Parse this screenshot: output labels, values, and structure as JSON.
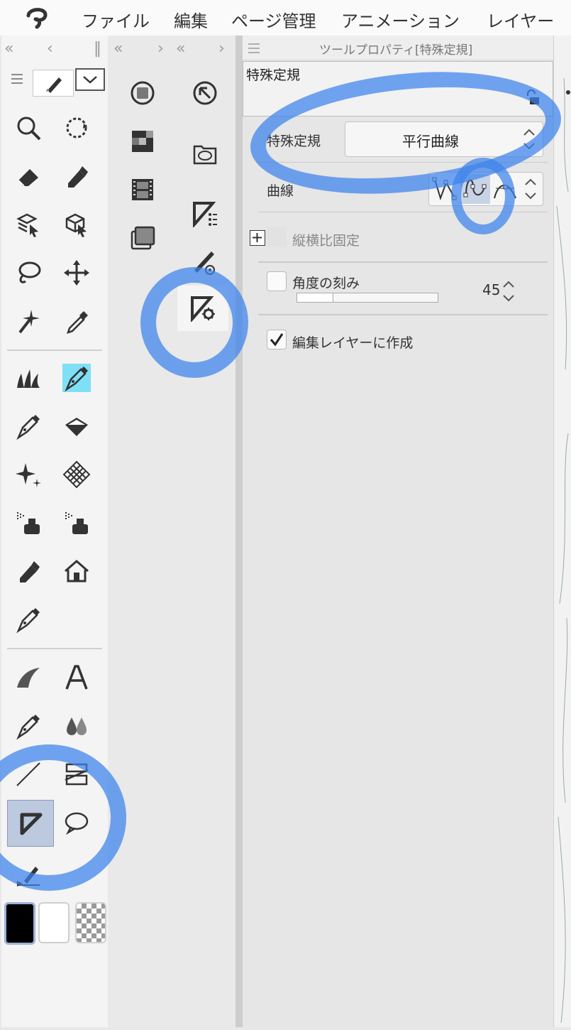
{
  "menu": [
    "ファイル",
    "編集",
    "ページ管理",
    "アニメーション",
    "レイヤー"
  ],
  "panel": {
    "title": "ツールプロパティ[特殊定規]",
    "subtool_name": "特殊定規",
    "special_ruler_label": "特殊定規",
    "special_ruler_value": "平行曲線",
    "curve_label": "曲線",
    "aspect_label": "縦横比固定",
    "angle_step_label": "角度の刻み",
    "angle_step_value": "45",
    "create_on_edit_layer_label": "編集レイヤーに作成",
    "create_on_edit_layer_checked": true,
    "angle_step_checked": false
  },
  "annotation_color": "#3c82eb",
  "selected_color": "#bcc9de",
  "accent_cyan": "#7fe0f5"
}
